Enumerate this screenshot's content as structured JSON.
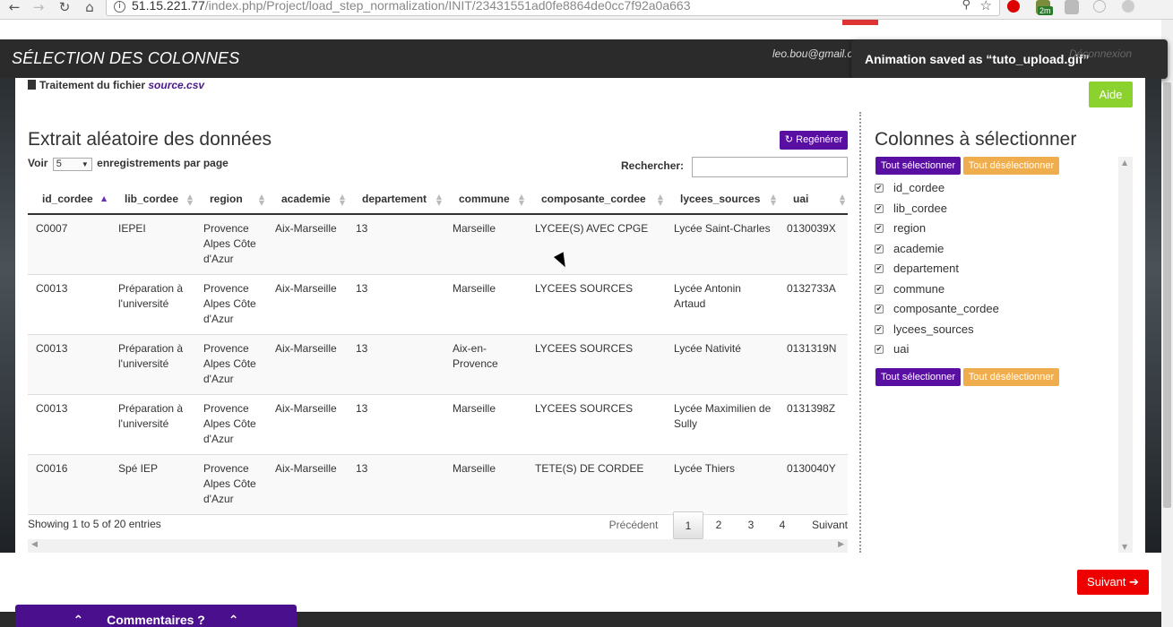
{
  "browser": {
    "url_host": "51.15.221.77",
    "url_path": "/index.php/Project/load_step_normalization/INIT/23431551ad0fe8864de0cc7f92a0a663",
    "ext_badge": "2m"
  },
  "header": {
    "title": "SÉLECTION DES COLONNES",
    "user_email": "leo.bou@gmail.com",
    "logout": "Déconnexion"
  },
  "toast": {
    "message": "Animation saved as “tuto_upload.gif”"
  },
  "file": {
    "prefix": "Traitement du fichier",
    "name": "source.csv"
  },
  "aide_label": "Aide",
  "left": {
    "title": "Extrait aléatoire des données",
    "regen_label": "Regénérer",
    "show_prefix": "Voir",
    "show_value": "5",
    "show_suffix": "enregistrements par page",
    "search_label": "Rechercher:",
    "search_value": "",
    "columns": [
      "id_cordee",
      "lib_cordee",
      "region",
      "academie",
      "departement",
      "commune",
      "composante_cordee",
      "lycees_sources",
      "uai"
    ],
    "rows": [
      [
        "C0007",
        "IEPEI",
        "Provence Alpes Côte d'Azur",
        "Aix-Marseille",
        "13",
        "Marseille",
        "LYCEE(S) AVEC CPGE",
        "Lycée Saint-Charles",
        "0130039X"
      ],
      [
        "C0013",
        "Préparation à l'université",
        "Provence Alpes Côte d'Azur",
        "Aix-Marseille",
        "13",
        "Marseille",
        "LYCEES SOURCES",
        "Lycée Antonin Artaud",
        "0132733A"
      ],
      [
        "C0013",
        "Préparation à l'université",
        "Provence Alpes Côte d'Azur",
        "Aix-Marseille",
        "13",
        "Aix-en-Provence",
        "LYCEES SOURCES",
        "Lycée Nativité",
        "0131319N"
      ],
      [
        "C0013",
        "Préparation à l'université",
        "Provence Alpes Côte d'Azur",
        "Aix-Marseille",
        "13",
        "Marseille",
        "LYCEES SOURCES",
        "Lycée Maximilien de Sully",
        "0131398Z"
      ],
      [
        "C0016",
        "Spé IEP",
        "Provence Alpes Côte d'Azur",
        "Aix-Marseille",
        "13",
        "Marseille",
        "TETE(S) DE CORDEE",
        "Lycée Thiers",
        "0130040Y"
      ]
    ],
    "showing": "Showing 1 to 5 of 20 entries",
    "pager": {
      "prev": "Précédent",
      "pages": [
        "1",
        "2",
        "3",
        "4"
      ],
      "current": "1",
      "next": "Suivant"
    }
  },
  "right": {
    "title": "Colonnes à sélectionner",
    "select_all": "Tout sélectionner",
    "deselect_all": "Tout désélectionner",
    "columns": [
      "id_cordee",
      "lib_cordee",
      "region",
      "academie",
      "departement",
      "commune",
      "composante_cordee",
      "lycees_sources",
      "uai"
    ]
  },
  "next_label": "Suivant",
  "comments_label": "Commentaires ?",
  "colors": {
    "purple": "#5a0fa3",
    "green": "#8bd22f",
    "orange": "#f0ad4e",
    "red": "#ee0000",
    "dark": "#2b2b2b"
  }
}
